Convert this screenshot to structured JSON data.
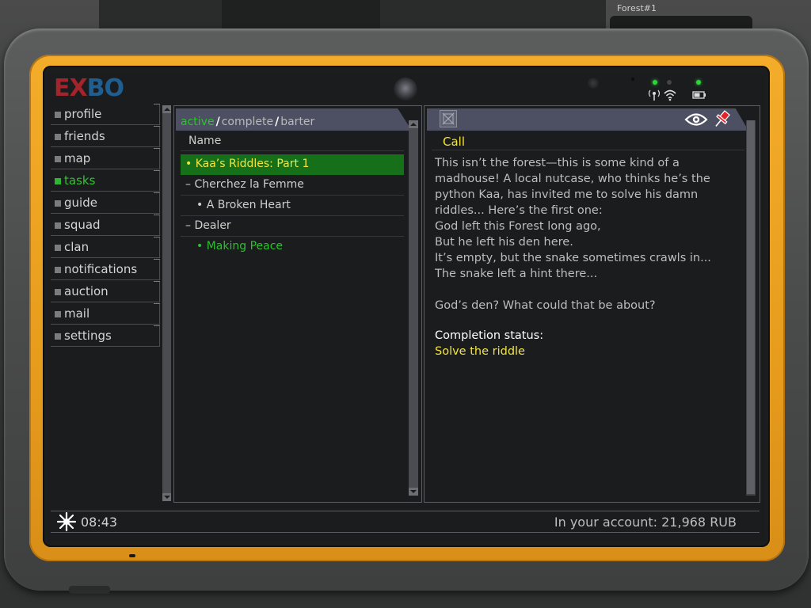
{
  "scene": {
    "top_label": "Forest#1"
  },
  "header": {
    "logo_part1": "EX",
    "logo_part2": "BO"
  },
  "sidebar": {
    "items": [
      {
        "label": "profile",
        "active": false
      },
      {
        "label": "friends",
        "active": false
      },
      {
        "label": "map",
        "active": false
      },
      {
        "label": "tasks",
        "active": true
      },
      {
        "label": "guide",
        "active": false
      },
      {
        "label": "squad",
        "active": false
      },
      {
        "label": "clan",
        "active": false
      },
      {
        "label": "notifications",
        "active": false
      },
      {
        "label": "auction",
        "active": false
      },
      {
        "label": "mail",
        "active": false
      },
      {
        "label": "settings",
        "active": false
      }
    ]
  },
  "tasks_panel": {
    "tabs": {
      "active": "active",
      "sep": "/",
      "complete": "complete",
      "barter": "barter"
    },
    "column_header": "Name",
    "rows": [
      {
        "text": "• Kaa’s Riddles: Part 1",
        "state": "selected"
      },
      {
        "text": "– Cherchez la Femme",
        "state": "normal"
      },
      {
        "text": "• A Broken Heart",
        "state": "normal"
      },
      {
        "text": "– Dealer",
        "state": "normal"
      },
      {
        "text": "• Making Peace",
        "state": "green"
      }
    ]
  },
  "detail_panel": {
    "call_label": "Call",
    "body_lines": [
      "This isn’t the forest—this is some kind of a",
      "madhouse! A local nutcase, who thinks he’s the",
      "python Kaa, has invited me to solve his damn",
      "riddles... Here’s the first one:",
      "God left this Forest long ago,",
      "But he left his den here.",
      "It’s empty, but the snake sometimes crawls in...",
      "The snake left a hint there...",
      "",
      "God’s den? What could that be about?"
    ],
    "completion_label": "Completion status:",
    "completion_value": "Solve the riddle"
  },
  "footer": {
    "time": "08:43",
    "account_text": "In your account: 21,968 RUB"
  },
  "colors": {
    "frame": "#e79c1c",
    "active_green": "#2ec02e",
    "highlight_yellow": "#f2e540",
    "selected_row": "#157019",
    "panel_header": "#4d5062"
  }
}
